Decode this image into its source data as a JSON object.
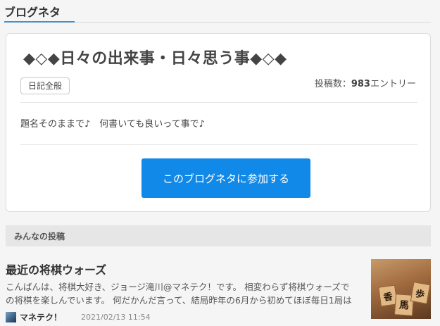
{
  "section": {
    "title": "ブログネタ"
  },
  "card": {
    "title": "◆◇◆日々の出来事・日々思う事◆◇◆",
    "tag": "日記全般",
    "post_count_label": "投稿数：",
    "post_count_value": "983",
    "post_count_unit": "エントリー",
    "description": "題名そのままで♪　何書いても良いって事で♪",
    "join_button": "このブログネタに参加する"
  },
  "community": {
    "title": "みんなの投稿"
  },
  "entry": {
    "title": "最近の将棋ウォーズ",
    "lines": [
      "こんばんは、将棋大好き、ジョージ滝川@マネテク！です。 相変わらず将棋ウォーズで",
      "の将棋を楽しんでいます。 何だかんだ言って、結局昨年の6月から初めてほぼ毎日1局は"
    ],
    "author": "マネテク！",
    "date": "2021/02/13 11:54",
    "thumbnail_chars": [
      "香",
      "馬",
      "歩"
    ]
  },
  "colors": {
    "accent": "#1189e8",
    "tab_underline": "#4a90c8"
  }
}
